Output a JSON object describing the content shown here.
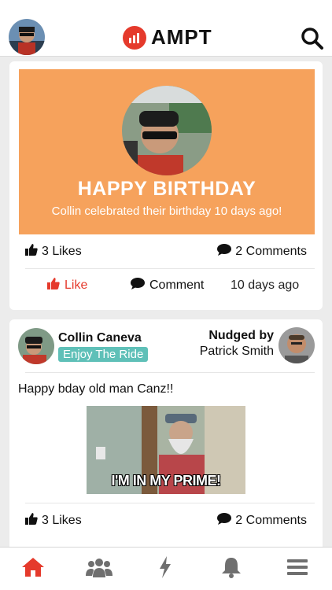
{
  "header": {
    "logo_text": "AMPT",
    "brand_color": "#e53a2c",
    "search_icon": "search-icon",
    "avatar_icon": "avatar"
  },
  "birthday_card": {
    "title": "HAPPY BIRTHDAY",
    "subtitle": "Collin celebrated their birthday 10 days ago!",
    "background_color": "#f6a25c",
    "likes_label": "3 Likes",
    "comments_label": "2 Comments",
    "like_button_label": "Like",
    "comment_button_label": "Comment",
    "time_label": "10 days ago"
  },
  "post_card": {
    "author_name": "Collin Caneva",
    "author_tag": "Enjoy The Ride",
    "tag_color": "#5fc0b8",
    "nudged_by_label": "Nudged by",
    "nudger_name": "Patrick Smith",
    "text": "Happy bday old man Canz!!",
    "gif_caption": "I'M IN MY PRIME!",
    "likes_label": "3 Likes",
    "comments_label": "2 Comments"
  },
  "nav": {
    "items": [
      {
        "icon": "home-icon",
        "active": true
      },
      {
        "icon": "group-icon",
        "active": false
      },
      {
        "icon": "lightning-icon",
        "active": false
      },
      {
        "icon": "bell-icon",
        "active": false
      },
      {
        "icon": "menu-icon",
        "active": false
      }
    ],
    "active_color": "#e53a2c",
    "inactive_color": "#6f6f6f"
  }
}
